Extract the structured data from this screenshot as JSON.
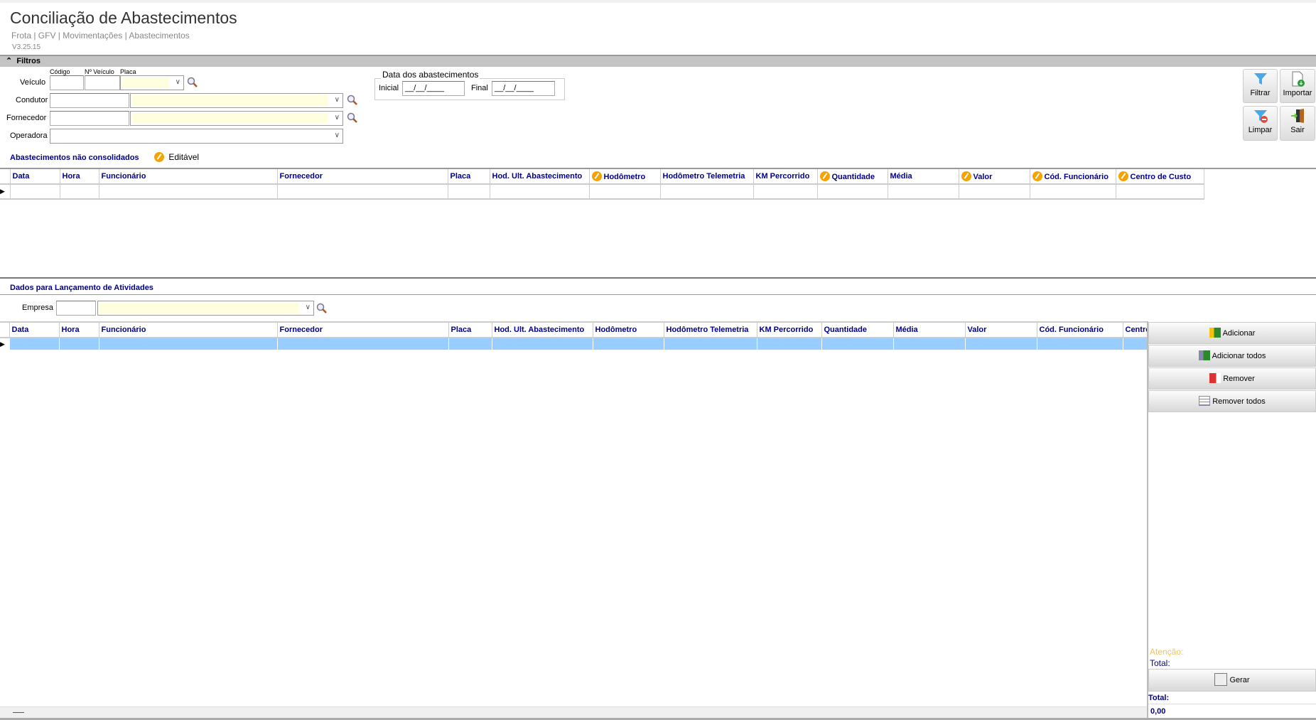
{
  "header": {
    "title": "Conciliação de Abastecimentos",
    "breadcrumb": "Frota | GFV | Movimentações | Abastecimentos",
    "version": "V3.25.15"
  },
  "filters": {
    "title": "Filtros",
    "veiculo_label": "Veículo",
    "codigo_label": "Código",
    "nveiculo_label": "Nº Veículo",
    "placa_label": "Placa",
    "condutor_label": "Condutor",
    "fornecedor_label": "Fornecedor",
    "operadora_label": "Operadora",
    "date_group": "Data dos abastecimentos",
    "inicial_label": "Inicial",
    "inicial_value": "__/__/____",
    "final_label": "Final",
    "final_value": "__/__/____"
  },
  "toolbar": {
    "filtrar": "Filtrar",
    "importar": "Importar",
    "limpar": "Limpar",
    "sair": "Sair"
  },
  "grid1": {
    "title": "Abastecimentos não consolidados",
    "editable_legend": "Editável",
    "columns": [
      {
        "label": "Data",
        "editable": false
      },
      {
        "label": "Hora",
        "editable": false
      },
      {
        "label": "Funcionário",
        "editable": false
      },
      {
        "label": "Fornecedor",
        "editable": false
      },
      {
        "label": "Placa",
        "editable": false
      },
      {
        "label": "Hod. Ult. Abastecimento",
        "editable": false
      },
      {
        "label": "Hodômetro",
        "editable": true
      },
      {
        "label": "Hodômetro Telemetria",
        "editable": false
      },
      {
        "label": "KM Percorrido",
        "editable": false
      },
      {
        "label": "Quantidade",
        "editable": true
      },
      {
        "label": "Média",
        "editable": false
      },
      {
        "label": "Valor",
        "editable": true
      },
      {
        "label": "Cód. Funcionário",
        "editable": true
      },
      {
        "label": "Centro de Custo",
        "editable": true
      }
    ]
  },
  "launch": {
    "title": "Dados para Lançamento de Atividades",
    "empresa_label": "Empresa"
  },
  "grid2": {
    "columns": [
      "Data",
      "Hora",
      "Funcionário",
      "Fornecedor",
      "Placa",
      "Hod. Ult. Abastecimento",
      "Hodômetro",
      "Hodômetro Telemetria",
      "KM Percorrido",
      "Quantidade",
      "Média",
      "Valor",
      "Cód. Funcionário",
      "Centro de Custo"
    ]
  },
  "side": {
    "adicionar": "Adicionar",
    "adicionar_todos": "Adicionar todos",
    "remover": "Remover",
    "remover_todos": "Remover todos",
    "atencao": "Atenção:",
    "total_label": "Total:",
    "gerar": "Gerar",
    "total2_label": "Total:",
    "total_value": "0,00"
  },
  "colors": {
    "accent": "#00008b",
    "editable": "#f5a300",
    "selected_row": "#99ccff",
    "input_fill": "#ffffe0"
  }
}
